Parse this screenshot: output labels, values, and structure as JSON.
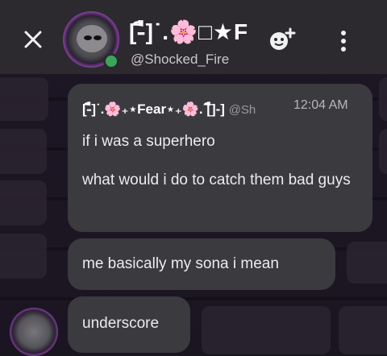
{
  "header": {
    "title_prefix": "[-ื]˙.",
    "title_flower": "🌸",
    "title_suffix": "□★F",
    "handle": "@Shocked_Fire"
  },
  "messages": [
    {
      "name_prefix": "[-ื]˙.",
      "name_flower1": "🌸",
      "name_middle": "₊⋆Fear⋆₊",
      "name_flower2": "🌸",
      "name_suffix": ". [ื]-]",
      "handle_trunc": "@Sh",
      "time": "12:04 AM",
      "lines": [
        "if i was a superhero",
        "what would i do to catch them bad guys"
      ]
    },
    {
      "text": "me basically my sona i mean"
    },
    {
      "text": "underscore"
    }
  ],
  "colors": {
    "header_bg": "#2c2a2e",
    "bubble_bg": "#3a3a3f",
    "online": "#3ba55c",
    "accent_purple": "#b04bd8"
  },
  "icons": {
    "close": "close-icon",
    "add_friend": "add-friend-icon",
    "more": "more-vertical-icon"
  }
}
